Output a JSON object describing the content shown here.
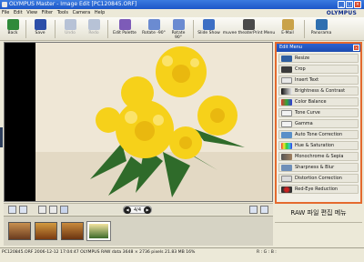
{
  "window": {
    "title": "OLYMPUS Master - Image Edit [PC120845.ORF]"
  },
  "menu": [
    "File",
    "Edit",
    "View",
    "Filter",
    "Tools",
    "Camera",
    "Help"
  ],
  "brand": "OLYMPUS",
  "toolbar": {
    "buttons": [
      {
        "label": "Back",
        "icon": "back-arrow-icon"
      },
      {
        "label": "Save",
        "icon": "floppy-disk-icon"
      },
      {
        "label": "Undo",
        "icon": "undo-icon"
      },
      {
        "label": "Redo",
        "icon": "redo-icon"
      },
      {
        "label": "Edit Palette",
        "icon": "palette-icon"
      },
      {
        "label": "Rotate -90°",
        "icon": "rotate-left-icon"
      },
      {
        "label": "Rotate 90°",
        "icon": "rotate-right-icon"
      },
      {
        "label": "Slide Show",
        "icon": "slideshow-icon"
      },
      {
        "label": "muvee theaterPrint Menu",
        "icon": "print-icon"
      },
      {
        "label": "E-Mail",
        "icon": "email-icon"
      },
      {
        "label": "Panorama",
        "icon": "panorama-icon"
      }
    ]
  },
  "viewer": {
    "page_indicator": "4/4"
  },
  "edit_menu": {
    "title": "Edit Menu",
    "items": [
      "Resize",
      "Crop",
      "Insert Text",
      "Brightness & Contrast",
      "Color Balance",
      "Tone Curve",
      "Gamma",
      "Auto Tone Correction",
      "Hue & Saturation",
      "Monochrome & Sepia",
      "Sharpness & Blur",
      "Distortion Correction",
      "Red-Eye Reduction"
    ]
  },
  "raw_caption": "RAW 파일 편집 메뉴",
  "status": {
    "text": "PC120845.ORF   2006-12-12 17:04:47  OLYMPUS RAW data  3648 × 2736 pixels  21.83 MB   16%",
    "rgb": "R :      G :      B :"
  },
  "colors": {
    "accent": "#e46a2e",
    "titlebar": "#1c57c8",
    "flower": "#f6d11a"
  }
}
